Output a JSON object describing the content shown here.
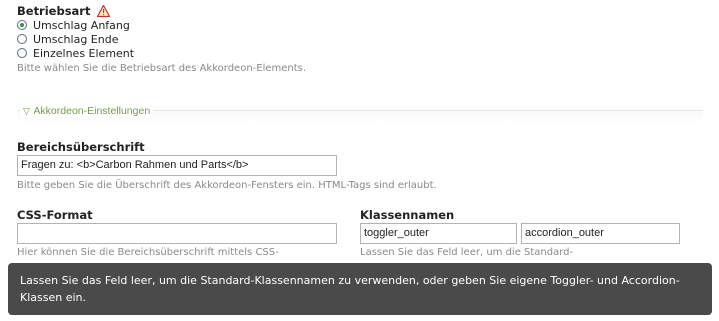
{
  "mode": {
    "label": "Betriebsart",
    "options": [
      "Umschlag Anfang",
      "Umschlag Ende",
      "Einzelnes Element"
    ],
    "selected": 0,
    "help": "Bitte wählen Sie die Betriebsart des Akkordeon-Elements."
  },
  "accordion": {
    "legend": "Akkordeon-Einstellungen",
    "heading_label": "Bereichsüberschrift",
    "heading_value": "Fragen zu: <b>Carbon Rahmen und Parts</b>",
    "heading_help": "Bitte geben Sie die Überschrift des Akkordeon-Fensters ein. HTML-Tags sind erlaubt.",
    "css_label": "CSS-Format",
    "css_value": "",
    "css_help": "Hier können Sie die Bereichsüberschrift mittels CSS-",
    "class_label": "Klassennamen",
    "class_toggler": "toggler_outer",
    "class_accordion": "accordion_outer",
    "class_help": "Lassen Sie das Feld leer, um die Standard-"
  },
  "tooltip": {
    "text": "Lassen Sie das Feld leer, um die Standard-Klassennamen zu verwenden, oder geben Sie eigene Toggler- und Accordion-Klassen ein."
  },
  "icons": {
    "warning": "warning-icon",
    "legend_toggle": "triangle-down-icon"
  },
  "colors": {
    "legend": "#6ea23f",
    "warning": "#d22c2c",
    "radio_selected": "#2f9a2f",
    "tooltip_bg": "#4a4a4a"
  }
}
